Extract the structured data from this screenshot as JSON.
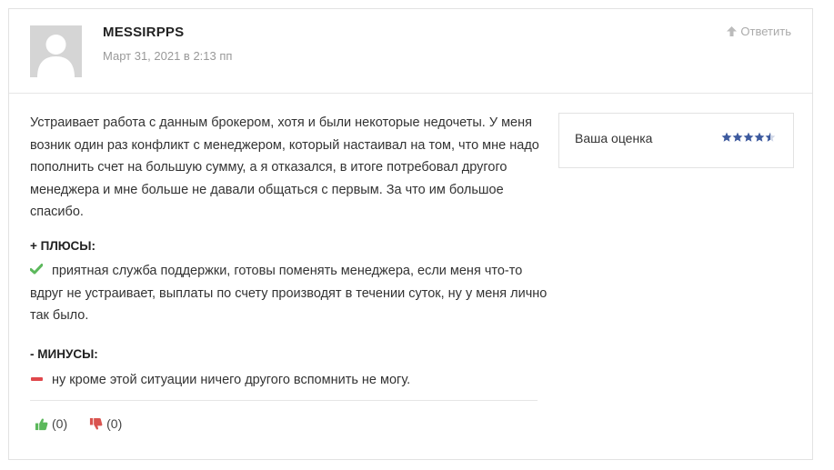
{
  "review": {
    "author": "MESSIRPPS",
    "date": "Март 31, 2021 в 2:13 пп",
    "reply_label": "Ответить",
    "text": "Устраивает работа с данным брокером, хотя и были некоторые недочеты. У меня возник один раз конфликт с менеджером, который настаивал на том, что мне надо пополнить счет на большую сумму, а я отказался, в итоге потребовал другого менеджера и мне больше не давали общаться с первым. За что им большое спасибо.",
    "pros_title": "+ ПЛЮСЫ:",
    "pros_text": "приятная служба поддержки, готовы поменять менеджера, если меня что-то вдруг не устраивает, выплаты по счету производят в течении суток, ну у меня лично так было.",
    "cons_title": "- МИНУСЫ:",
    "cons_text": "ну кроме этой ситуации ничего другого вспомнить не могу.",
    "likes": "(0)",
    "dislikes": "(0)"
  },
  "rating": {
    "label": "Ваша оценка",
    "value": 4.5,
    "max": 5
  },
  "icons": {
    "reply": "arrow-up-icon",
    "pros": "checkmark-icon",
    "cons": "minus-icon",
    "like": "thumbs-up-icon",
    "dislike": "thumbs-down-icon",
    "star": "star-icon"
  },
  "colors": {
    "star": "#3d5a9e",
    "check": "#5cb85c",
    "minus": "#e0474c",
    "like": "#5cb85c",
    "dislike": "#d9534f",
    "muted": "#999999"
  }
}
